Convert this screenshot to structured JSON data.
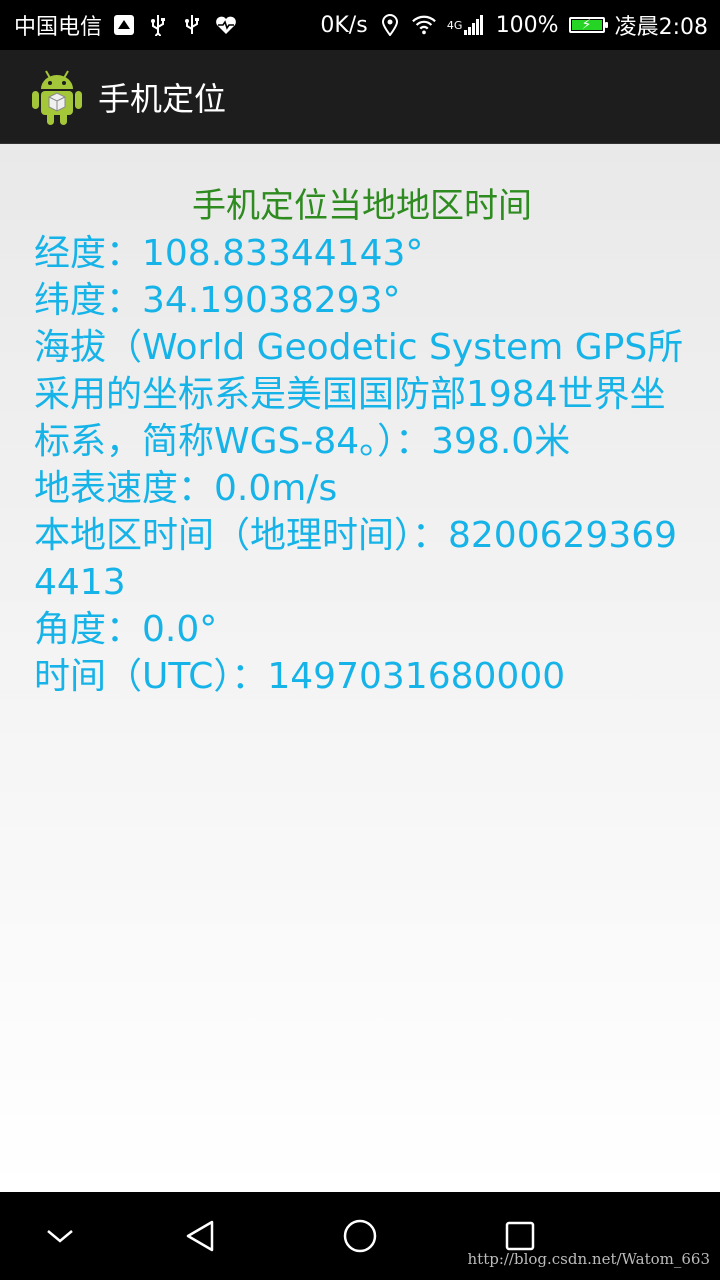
{
  "status_bar": {
    "carrier": "中国电信",
    "speed": "0K/s",
    "network": "4G",
    "battery": "100%",
    "battery_level": 1.0,
    "time": "凌晨2:08",
    "icons": [
      "huawei-notification-icon",
      "usb-icon",
      "usb-icon",
      "health-icon",
      "location-icon",
      "wifi-icon",
      "signal-icon",
      "battery-icon"
    ]
  },
  "action_bar": {
    "title": "手机定位",
    "logo_icon": "android-app-icon"
  },
  "content": {
    "heading": "手机定位当地地区时间",
    "heading_color": "#2e8b1f",
    "text_color": "#16b3e8",
    "longitude": "经度：108.83344143°",
    "latitude": "纬度：34.19038293°",
    "altitude": "海拔（World Geodetic System GPS所采用的坐标系是美国国防部1984世界坐标系，简称WGS-84。）：398.0米",
    "speed": "地表速度：0.0m/s",
    "local_time": "本地区时间（地理时间）：82006293694413",
    "bearing": "角度：0.0°",
    "utc_time": "时间（UTC）：1497031680000"
  },
  "nav_bar": {
    "buttons": [
      "chevron-down-icon",
      "back-icon",
      "home-icon",
      "recents-icon"
    ]
  },
  "watermark": "http://blog.csdn.net/Watom_663"
}
